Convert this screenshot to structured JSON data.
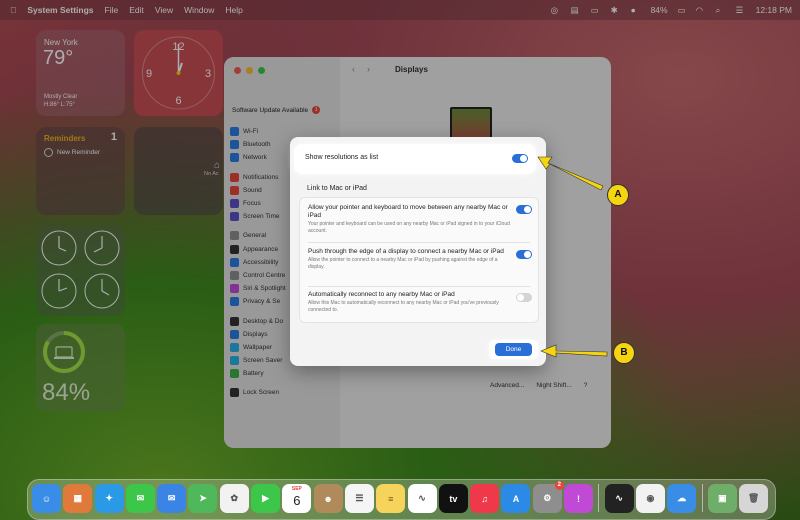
{
  "menubar": {
    "app": "System Settings",
    "menus": [
      "File",
      "Edit",
      "View",
      "Window",
      "Help"
    ],
    "battery": "84%",
    "time": "12:18 PM"
  },
  "widgets": {
    "weather": {
      "city": "New York",
      "temp": "79°",
      "condition": "Mostly Clear",
      "hilo": "H:86° L:75°"
    },
    "clock": {
      "numbers": [
        "12",
        "3",
        "6",
        "9"
      ]
    },
    "reminders": {
      "title": "Reminders",
      "count": "1",
      "item": "New Reminder"
    },
    "notes": {
      "label": "No Ac"
    },
    "battery": {
      "percent": "84%",
      "level": 0.84
    }
  },
  "settings": {
    "title": "Displays",
    "sidebar_update": "Software Update Available",
    "sidebar_update_badge": "1",
    "sidebar_items": [
      {
        "label": "Wi-Fi",
        "color": "#2a7ce6"
      },
      {
        "label": "Bluetooth",
        "color": "#2a7ce6"
      },
      {
        "label": "Network",
        "color": "#2a7ce6"
      },
      {
        "gap": true
      },
      {
        "label": "Notifications",
        "color": "#e8453c"
      },
      {
        "label": "Sound",
        "color": "#e8453c"
      },
      {
        "label": "Focus",
        "color": "#5a4fc9"
      },
      {
        "label": "Screen Time",
        "color": "#5a4fc9"
      },
      {
        "gap": true
      },
      {
        "label": "General",
        "color": "#8e8e8e"
      },
      {
        "label": "Appearance",
        "color": "#333333"
      },
      {
        "label": "Accessibility",
        "color": "#2a7ce6"
      },
      {
        "label": "Control Centre",
        "color": "#8e8e8e"
      },
      {
        "label": "Siri & Spotlight",
        "color": "#c04ad6"
      },
      {
        "label": "Privacy & Se",
        "color": "#2a7ce6"
      },
      {
        "gap": true
      },
      {
        "label": "Desktop & Do",
        "color": "#333333"
      },
      {
        "label": "Displays",
        "color": "#2a7ce6"
      },
      {
        "label": "Wallpaper",
        "color": "#2ab0e6"
      },
      {
        "label": "Screen Saver",
        "color": "#2ab0e6"
      },
      {
        "label": "Battery",
        "color": "#3cb043"
      },
      {
        "gap": true
      },
      {
        "label": "Lock Screen",
        "color": "#333333"
      }
    ],
    "bottom_buttons": [
      "Advanced...",
      "Night Shift...",
      "?"
    ]
  },
  "sheet": {
    "show_resolutions_label": "Show resolutions as list",
    "show_resolutions_on": true,
    "section_title": "Link to Mac or iPad",
    "options": [
      {
        "title": "Allow your pointer and keyboard to move between any nearby Mac or iPad",
        "desc": "Your pointer and keyboard can be used on any nearby Mac or iPad signed in to your iCloud account.",
        "on": true
      },
      {
        "title": "Push through the edge of a display to connect a nearby Mac or iPad",
        "desc": "Allow the pointer to connect to a nearby Mac or iPad by pushing against the edge of a display.",
        "on": true
      },
      {
        "title": "Automatically reconnect to any nearby Mac or iPad",
        "desc": "Allow this Mac to automatically reconnect to any nearby Mac or iPad you've previously connected to.",
        "on": false
      }
    ],
    "done_label": "Done"
  },
  "callouts": {
    "a": "A",
    "b": "B"
  },
  "dock": {
    "apps": [
      {
        "name": "finder",
        "color": "#3a8de6",
        "glyph": "☺"
      },
      {
        "name": "launchpad",
        "color": "#e07a3a",
        "glyph": "▦"
      },
      {
        "name": "safari",
        "color": "#2a9ae6",
        "glyph": "✦"
      },
      {
        "name": "messages",
        "color": "#3cc64a",
        "glyph": "✉"
      },
      {
        "name": "mail",
        "color": "#3a84e6",
        "glyph": "✉"
      },
      {
        "name": "maps",
        "color": "#4fb85a",
        "glyph": "➤"
      },
      {
        "name": "photos",
        "color": "#f2f2f2",
        "glyph": "✿"
      },
      {
        "name": "facetime",
        "color": "#3cc64a",
        "glyph": "▶"
      },
      {
        "name": "calendar",
        "color": "#ffffff",
        "glyph": ""
      },
      {
        "name": "contacts",
        "color": "#b08a5a",
        "glyph": "☻"
      },
      {
        "name": "reminders",
        "color": "#f5f5f5",
        "glyph": "☰"
      },
      {
        "name": "notes",
        "color": "#f6d35a",
        "glyph": "≡"
      },
      {
        "name": "freeform",
        "color": "#ffffff",
        "glyph": "∿"
      },
      {
        "name": "tv",
        "color": "#111111",
        "glyph": "tv"
      },
      {
        "name": "music",
        "color": "#f0384b",
        "glyph": "♫"
      },
      {
        "name": "app-store",
        "color": "#2a8ae6",
        "glyph": "A"
      },
      {
        "name": "system-settings",
        "color": "#8e8e8e",
        "glyph": "⚙"
      },
      {
        "name": "feedback",
        "color": "#c04ad6",
        "glyph": "!"
      },
      {
        "name": "sep",
        "color": "",
        "glyph": ""
      },
      {
        "name": "voice-memos",
        "color": "#222222",
        "glyph": "∿"
      },
      {
        "name": "chrome",
        "color": "#f2f2f2",
        "glyph": "◉"
      },
      {
        "name": "weather",
        "color": "#3a8de6",
        "glyph": "☁"
      },
      {
        "name": "sep",
        "color": "",
        "glyph": ""
      },
      {
        "name": "preview",
        "color": "#6fae6a",
        "glyph": "▣"
      },
      {
        "name": "trash",
        "color": "#d6d6d6",
        "glyph": "🗑"
      }
    ],
    "calendar_month": "SEP",
    "calendar_day": "6",
    "settings_badge": "2"
  }
}
